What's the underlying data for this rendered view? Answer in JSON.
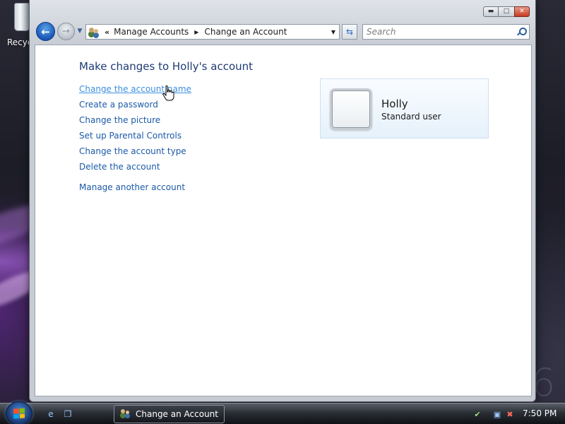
{
  "desktop": {
    "recycle_bin_label": "Recycl",
    "wallpaper_text": "6"
  },
  "window": {
    "caption": {
      "minimize_symbol": "▬",
      "maximize_symbol": "□",
      "close_symbol": "✕"
    },
    "nav": {
      "back_icon": "back-arrow-icon",
      "forward_icon": "forward-arrow-icon",
      "back_symbol": "←",
      "forward_symbol": "→",
      "history_symbol": "▼"
    },
    "address": {
      "chevrons": "«",
      "segments": [
        "Manage Accounts",
        "Change an Account"
      ],
      "separator_symbol": "▶",
      "dropdown_symbol": "▼"
    },
    "refresh_symbol": "⇆",
    "search": {
      "placeholder": "Search"
    }
  },
  "main": {
    "title": "Make changes to Holly's account",
    "tasks": [
      "Change the account name",
      "Create a password",
      "Change the picture",
      "Set up Parental Controls",
      "Change the account type",
      "Delete the account"
    ],
    "other_task": "Manage another account",
    "hovered_task_index": 0,
    "account": {
      "name": "Holly",
      "type": "Standard user"
    }
  },
  "taskbar": {
    "running_task_label": "Change an Account",
    "clock": "7:50 PM",
    "quick_launch_icons": [
      "ie-icon",
      "switch-windows-icon"
    ],
    "tray_icons": [
      "security-icon",
      "network-icon",
      "volume-muted-icon"
    ]
  },
  "colors": {
    "link": "#1b5aa8",
    "link_hover": "#3c8fe0",
    "title": "#1e3b73",
    "card_bg": "#e6f1fb"
  }
}
